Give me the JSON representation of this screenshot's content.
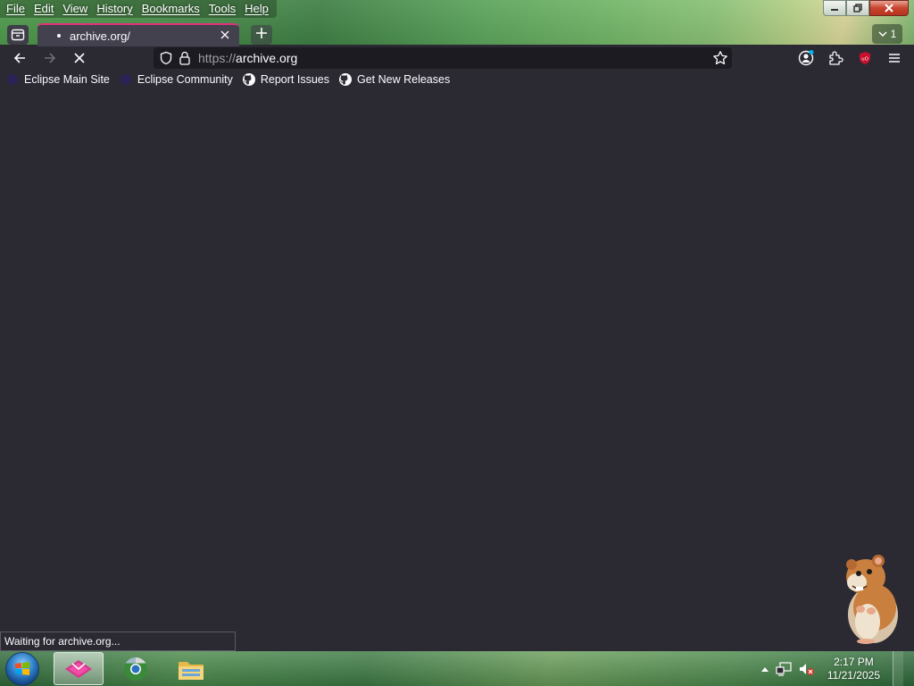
{
  "menubar": {
    "items": [
      "File",
      "Edit",
      "View",
      "History",
      "Bookmarks",
      "Tools",
      "Help"
    ]
  },
  "tabs": {
    "active_title": "archive.org/",
    "overflow_count": "1"
  },
  "navbar": {
    "url_scheme": "https://",
    "url_host": "archive.org"
  },
  "bookmarks": [
    {
      "label": "Eclipse Main Site",
      "icon": "eclipse-icon"
    },
    {
      "label": "Eclipse Community",
      "icon": "eclipse-icon"
    },
    {
      "label": "Report Issues",
      "icon": "github-icon"
    },
    {
      "label": "Get New Releases",
      "icon": "github-icon"
    }
  ],
  "status": {
    "text": "Waiting for archive.org..."
  },
  "taskbar": {
    "time": "2:17 PM",
    "date": "11/21/2025"
  },
  "colors": {
    "tab_accent": "#e1307a",
    "browser_bg": "#2b2a33",
    "urlbar_bg": "#1c1b22"
  }
}
